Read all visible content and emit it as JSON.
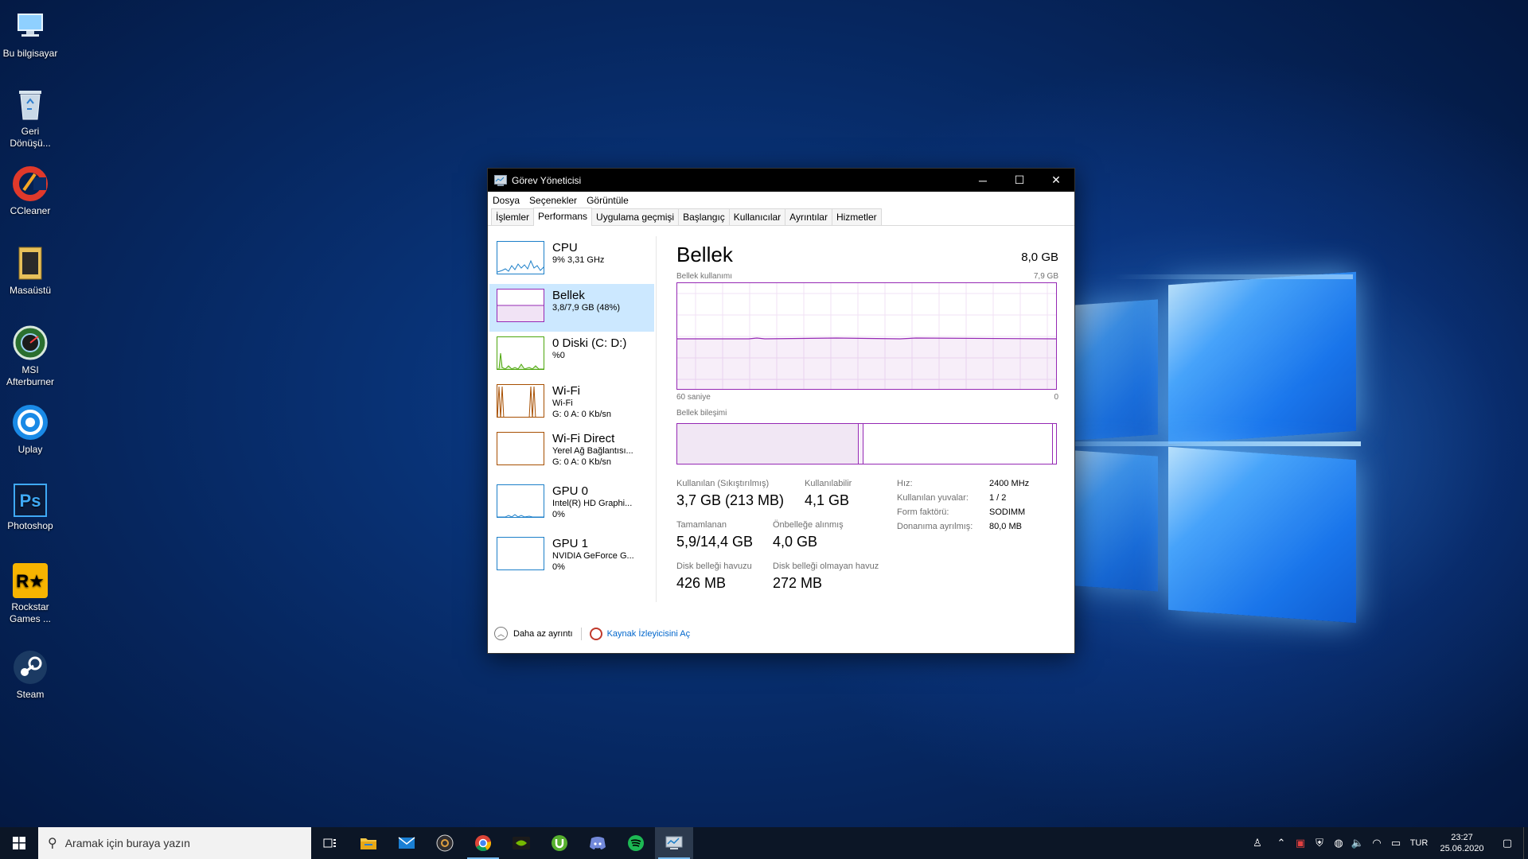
{
  "desktop": {
    "icons": [
      {
        "name": "bu-bilgisayar",
        "label": "Bu bilgisayar",
        "icon": "computer-icon"
      },
      {
        "name": "geri-donusum",
        "label": "Geri Dönüşü...",
        "icon": "recycle-bin-icon"
      },
      {
        "name": "ccleaner",
        "label": "CCleaner",
        "icon": "ccleaner-icon"
      },
      {
        "name": "masaustu",
        "label": "Masaüstü",
        "icon": "folder-icon"
      },
      {
        "name": "msi-afterburner",
        "label": "MSI Afterburner",
        "icon": "afterburner-icon"
      },
      {
        "name": "uplay",
        "label": "Uplay",
        "icon": "uplay-icon"
      },
      {
        "name": "photoshop",
        "label": "Photoshop",
        "icon": "photoshop-icon"
      },
      {
        "name": "rockstar",
        "label": "Rockstar Games ...",
        "icon": "rockstar-icon"
      },
      {
        "name": "steam",
        "label": "Steam",
        "icon": "steam-icon"
      }
    ]
  },
  "window": {
    "title": "Görev Yöneticisi",
    "menu": [
      "Dosya",
      "Seçenekler",
      "Görüntüle"
    ],
    "tabs": [
      "İşlemler",
      "Performans",
      "Uygulama geçmişi",
      "Başlangıç",
      "Kullanıcılar",
      "Ayrıntılar",
      "Hizmetler"
    ],
    "active_tab": "Performans"
  },
  "perf_list": [
    {
      "title": "CPU",
      "line2": "9%  3,31 GHz",
      "line3": "",
      "color": "#1c7fc9"
    },
    {
      "title": "Bellek",
      "line2": "3,8/7,9 GB (48%)",
      "line3": "",
      "color": "#9528b4"
    },
    {
      "title": "0 Diski (C: D:)",
      "line2": "%0",
      "line3": "",
      "color": "#4da60c"
    },
    {
      "title": "Wi-Fi",
      "line2": "Wi-Fi",
      "line3": "G: 0  A: 0 Kb/sn",
      "color": "#a74f01"
    },
    {
      "title": "Wi-Fi Direct",
      "line2": "Yerel Ağ Bağlantısı...",
      "line3": "G: 0  A: 0 Kb/sn",
      "color": "#a74f01"
    },
    {
      "title": "GPU 0",
      "line2": "Intel(R) HD Graphi...",
      "line3": "0%",
      "color": "#1c7fc9"
    },
    {
      "title": "GPU 1",
      "line2": "NVIDIA GeForce G...",
      "line3": "0%",
      "color": "#1c7fc9"
    }
  ],
  "memory": {
    "title": "Bellek",
    "total": "8,0 GB",
    "usage_label": "Bellek kullanımı",
    "usage_max": "7,9 GB",
    "time_left": "60 saniye",
    "time_right": "0",
    "composition_label": "Bellek bileşimi",
    "used_fraction": 0.48,
    "in_use_label": "Kullanılan (Sıkıştırılmış)",
    "in_use_value": "3,7 GB (213 MB)",
    "available_label": "Kullanılabilir",
    "available_value": "4,1 GB",
    "committed_label": "Tamamlanan",
    "committed_value": "5,9/14,4 GB",
    "cached_label": "Önbelleğe alınmış",
    "cached_value": "4,0 GB",
    "paged_label": "Disk belleği havuzu",
    "paged_value": "426 MB",
    "nonpaged_label": "Disk belleği olmayan havuz",
    "nonpaged_value": "272 MB",
    "speed_label": "Hız:",
    "speed_value": "2400 MHz",
    "slots_label": "Kullanılan yuvalar:",
    "slots_value": "1 / 2",
    "form_label": "Form faktörü:",
    "form_value": "SODIMM",
    "reserved_label": "Donanıma ayrılmış:",
    "reserved_value": "80,0 MB"
  },
  "footer": {
    "less_details": "Daha az ayrıntı",
    "resource_monitor": "Kaynak İzleyicisini Aç"
  },
  "taskbar": {
    "search_placeholder": "Aramak için buraya yazın",
    "apps": [
      "task-view-icon",
      "file-explorer-icon",
      "mail-icon",
      "obs-icon",
      "chrome-icon",
      "nvidia-icon",
      "utorrent-icon",
      "discord-icon",
      "spotify-icon",
      "task-manager-icon"
    ],
    "language": "TUR",
    "time": "23:27",
    "date": "25.06.2020"
  }
}
